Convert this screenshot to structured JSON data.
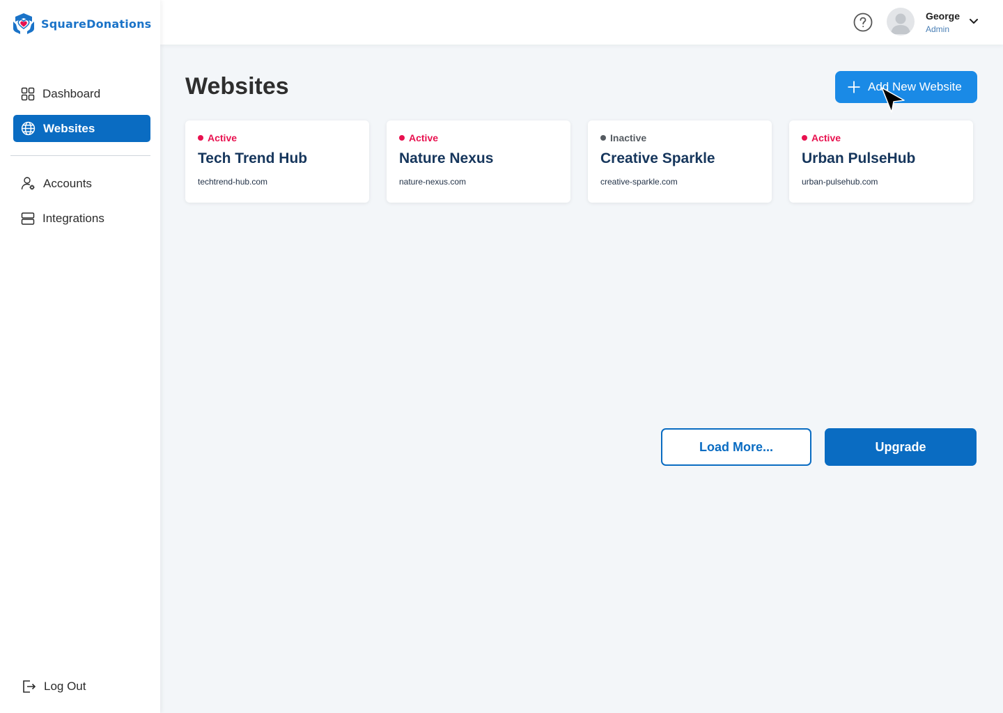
{
  "brand": {
    "name": "SquareDonations"
  },
  "sidebar": {
    "items": [
      {
        "label": "Dashboard",
        "icon": "grid-icon"
      },
      {
        "label": "Websites",
        "icon": "globe-icon",
        "active": true
      },
      {
        "label": "Accounts",
        "icon": "user-gear-icon"
      },
      {
        "label": "Integrations",
        "icon": "server-icon"
      }
    ],
    "logout_label": "Log Out"
  },
  "header": {
    "user_name": "George",
    "user_role": "Admin"
  },
  "main": {
    "title": "Websites",
    "add_button_label": "Add New Website",
    "cards": [
      {
        "status": "Active",
        "name": "Tech Trend Hub",
        "domain": "techtrend-hub.com"
      },
      {
        "status": "Active",
        "name": "Nature Nexus",
        "domain": "nature-nexus.com"
      },
      {
        "status": "Inactive",
        "name": "Creative Sparkle",
        "domain": "creative-sparkle.com"
      },
      {
        "status": "Active",
        "name": "Urban PulseHub",
        "domain": "urban-pulsehub.com"
      }
    ],
    "load_more_label": "Load More...",
    "upgrade_label": "Upgrade"
  },
  "colors": {
    "primary": "#0a6cc2",
    "accent_button": "#1a8ae6",
    "active_status": "#e8114f",
    "inactive_status": "#555b61",
    "background": "#f3f6f9"
  }
}
